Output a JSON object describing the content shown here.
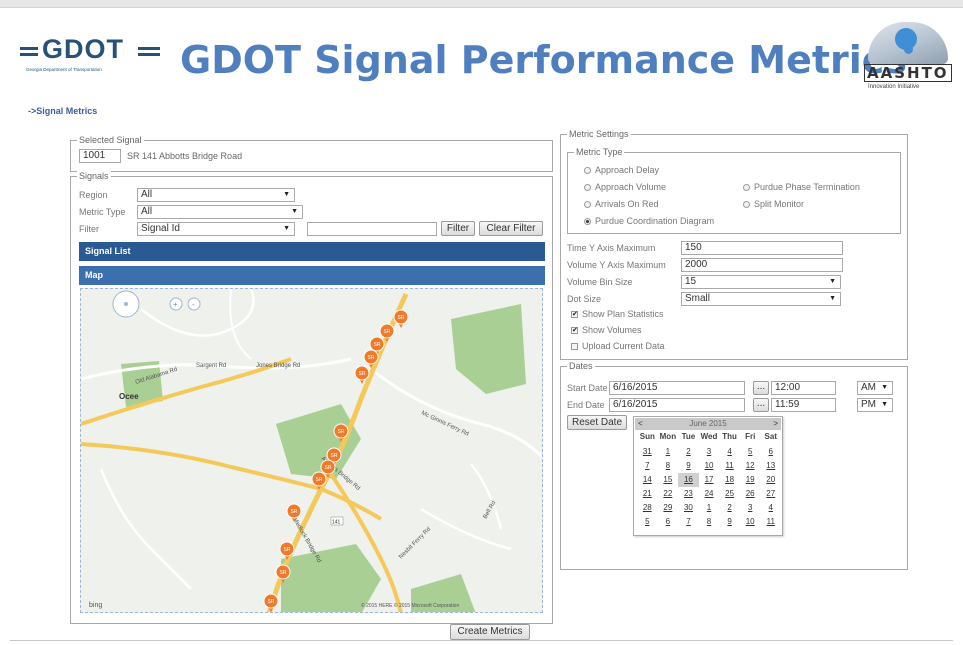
{
  "header": {
    "logo_text": "GDOT",
    "logo_subtitle": "Georgia Department of Transportation",
    "app_title": "GDOT Signal Performance Metrics",
    "partner_logo": "AASHTO",
    "partner_tagline": "Innovation Initiative"
  },
  "breadcrumb": "->Signal Metrics",
  "selected_signal": {
    "legend": "Selected Signal",
    "signal_id": "1001",
    "signal_name": "SR 141 Abbotts Bridge Road"
  },
  "signals": {
    "legend": "Signals",
    "region_label": "Region",
    "region_value": "All",
    "metric_type_label": "Metric Type",
    "metric_type_value": "All",
    "filter_label": "Filter",
    "filter_value": "Signal Id",
    "filter_text": "",
    "filter_button": "Filter",
    "clear_filter_button": "Clear Filter",
    "signal_list_bar": "Signal List",
    "map_bar": "Map"
  },
  "map": {
    "zoom_in": "+",
    "zoom_out": "-",
    "bing": "bing",
    "copyright": "© 2015 HERE   © 2015 Microsoft Corporation",
    "place_labels": [
      "Ocee",
      "Abbotts Bridge Rd",
      "Sargent Rd",
      "Jones Bridge Rd",
      "Old Alabama Rd",
      "Medlock Bridge Rd",
      "Mc Ginnis Ferry Rd",
      "Bell Rd",
      "Nesbit Ferry Rd"
    ],
    "marker_label": "SR",
    "marker_count": 13,
    "route_shield": "141"
  },
  "metric_settings": {
    "legend": "Metric Settings",
    "metric_type_legend": "Metric Type",
    "options": [
      {
        "label": "Approach Delay",
        "selected": false
      },
      {
        "label": "Approach Volume",
        "selected": false
      },
      {
        "label": "Arrivals On Red",
        "selected": false
      },
      {
        "label": "Purdue Coordination Diagram",
        "selected": true
      },
      {
        "label": "Purdue Phase Termination",
        "selected": false
      },
      {
        "label": "Split Monitor",
        "selected": false
      }
    ],
    "time_y_label": "Time Y Axis Maximum",
    "time_y_value": "150",
    "volume_y_label": "Volume Y Axis Maximum",
    "volume_y_value": "2000",
    "volume_bin_label": "Volume Bin Size",
    "volume_bin_value": "15",
    "dot_size_label": "Dot Size",
    "dot_size_value": "Small",
    "checkboxes": [
      {
        "label": "Show Plan Statistics",
        "checked": true
      },
      {
        "label": "Show Volumes",
        "checked": true
      },
      {
        "label": "Upload Current Data",
        "checked": false
      }
    ]
  },
  "dates": {
    "legend": "Dates",
    "start_label": "Start Date",
    "start_date": "6/16/2015",
    "start_time": "12:00",
    "start_ampm": "AM",
    "end_label": "End Date",
    "end_date": "6/16/2015",
    "end_time": "11:59",
    "end_ampm": "PM",
    "ellipsis": "...",
    "reset_button": "Reset Date"
  },
  "calendar": {
    "month_label": "June 2015",
    "prev": "<",
    "next": ">",
    "weekdays": [
      "Sun",
      "Mon",
      "Tue",
      "Wed",
      "Thu",
      "Fri",
      "Sat"
    ],
    "weeks": [
      [
        "31",
        "1",
        "2",
        "3",
        "4",
        "5",
        "6"
      ],
      [
        "7",
        "8",
        "9",
        "10",
        "11",
        "12",
        "13"
      ],
      [
        "14",
        "15",
        "16",
        "17",
        "18",
        "19",
        "20"
      ],
      [
        "21",
        "22",
        "23",
        "24",
        "25",
        "26",
        "27"
      ],
      [
        "28",
        "29",
        "30",
        "1",
        "2",
        "3",
        "4"
      ],
      [
        "5",
        "6",
        "7",
        "8",
        "9",
        "10",
        "11"
      ]
    ],
    "selected_day": "16"
  },
  "create_button": "Create Metrics",
  "colors": {
    "title_blue": "#4f7fbf",
    "bar_navy": "#2a5a93",
    "marker_orange": "#f07a2a",
    "road_yellow": "#f5c85a",
    "park_green": "#a9cf94"
  }
}
